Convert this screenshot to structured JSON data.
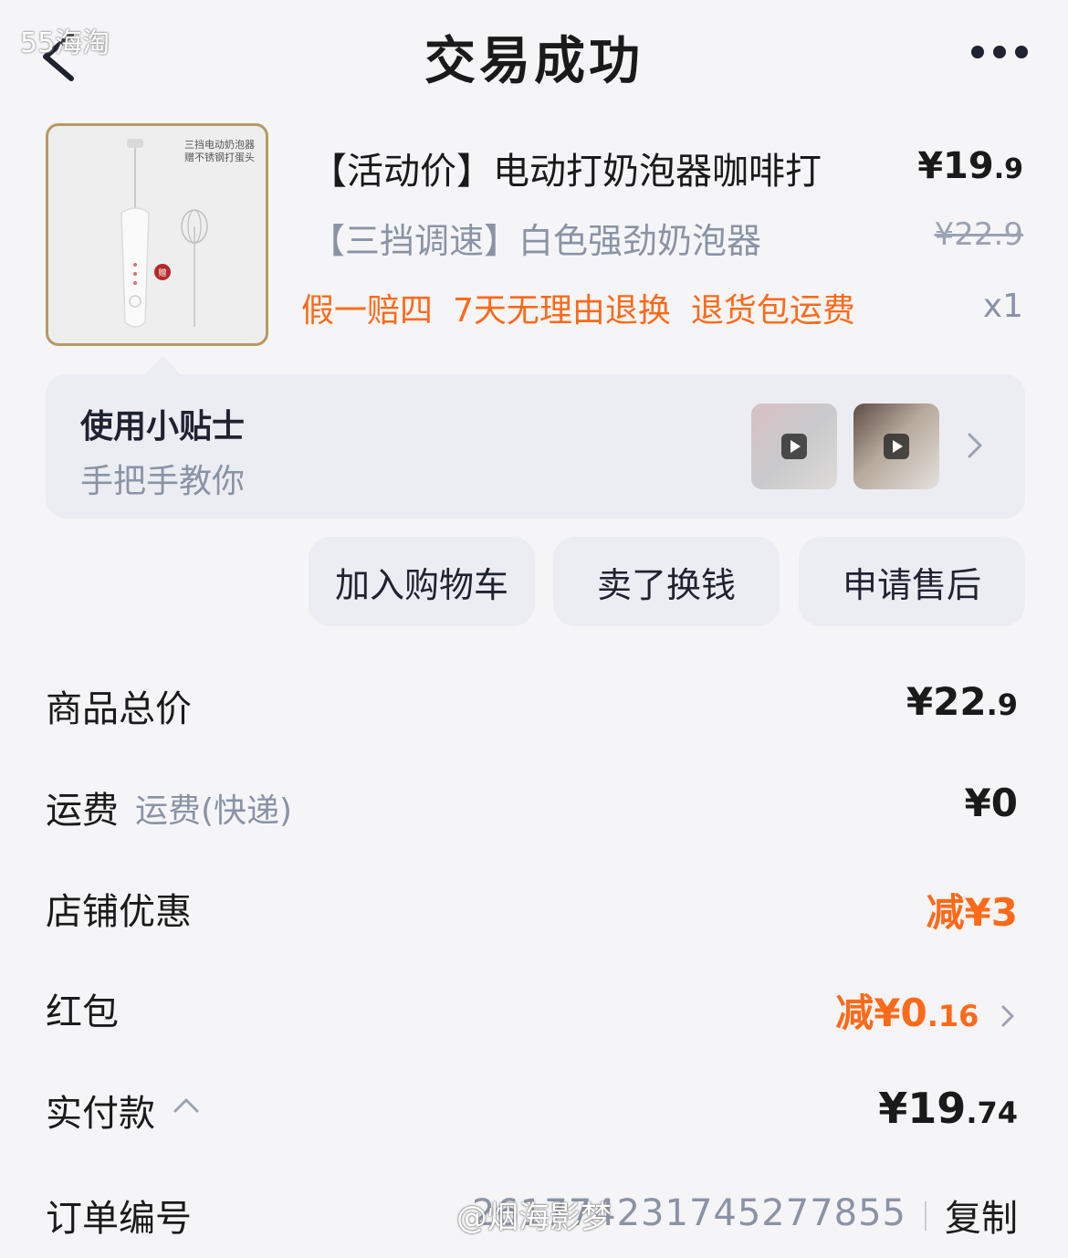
{
  "header": {
    "title": "交易成功",
    "watermark": "55海淘"
  },
  "product": {
    "name": "【活动价】电动打奶泡器咖啡打",
    "price_int": "¥19",
    "price_dec": ".9",
    "sku": "【三挡调速】白色强劲奶泡器",
    "original_price": "¥22.9",
    "tags": [
      "假一赔四",
      "7天无理由退换",
      "退货包运费"
    ],
    "quantity": "x1",
    "thumb_caption_1": "三挡电动奶泡器",
    "thumb_caption_2": "赠不锈钢打蛋头",
    "thumb_badge": "赠"
  },
  "tips": {
    "title": "使用小贴士",
    "subtitle": "手把手教你"
  },
  "actions": {
    "add_cart": "加入购物车",
    "sell": "卖了换钱",
    "after_sale": "申请售后"
  },
  "summary": {
    "total_label": "商品总价",
    "total_int": "¥22",
    "total_dec": ".9",
    "shipping_label": "运费",
    "shipping_sub": "运费(快递)",
    "shipping_value": "¥0",
    "shop_discount_label": "店铺优惠",
    "shop_discount_value": "减¥3",
    "red_packet_label": "红包",
    "red_packet_int": "减¥0",
    "red_packet_dec": ".16",
    "paid_label": "实付款",
    "paid_int": "¥19",
    "paid_dec": ".74",
    "order_label": "订单编号",
    "order_number": "2617742317452778​55",
    "copy_label": "复制"
  },
  "watermark_bottom": "@烟海影梦",
  "colors": {
    "accent_orange": "#ff6a1a",
    "muted_text": "#8a93a6",
    "card_bg": "#ebedf3",
    "thumb_border": "#b69a64"
  },
  "icons": {
    "back": "chevron-left-icon",
    "more": "more-dots-icon",
    "tips_more": "chevron-right-icon",
    "play": "play-icon",
    "paid_expand": "chevron-up-icon"
  }
}
